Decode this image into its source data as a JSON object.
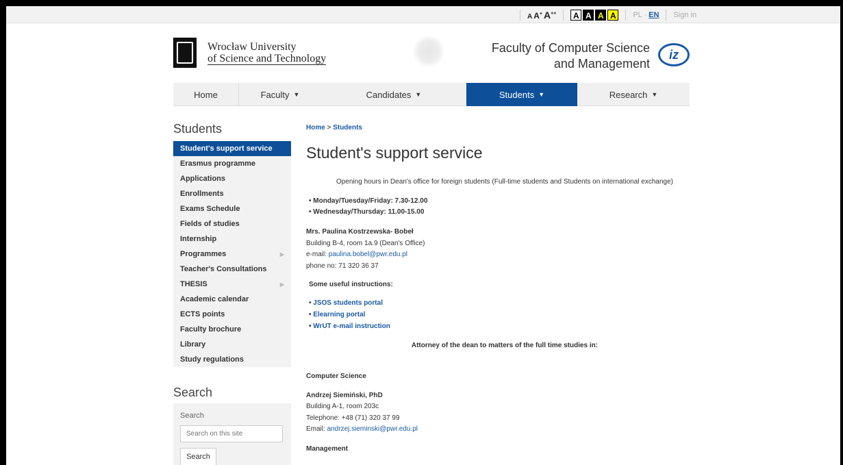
{
  "topbar": {
    "font_sizes": [
      "A",
      "A",
      "A"
    ],
    "font_size_marks": [
      "+",
      "++"
    ],
    "contrast": [
      "A",
      "A",
      "A",
      "A"
    ],
    "lang_pl": "PL",
    "lang_dot": "·",
    "lang_en": "EN",
    "sign_in": "Sign in"
  },
  "header": {
    "university_line1": "Wrocław University",
    "university_line2": "of Science and Technology",
    "faculty_line1": "Faculty of Computer Science",
    "faculty_line2": "and Management",
    "faculty_logo_text": "iz"
  },
  "nav": {
    "items": [
      {
        "label": "Home",
        "caret": ""
      },
      {
        "label": "Faculty",
        "caret": "▼"
      },
      {
        "label": "Candidates",
        "caret": "▼"
      },
      {
        "label": "Students",
        "caret": "▼"
      },
      {
        "label": "Research",
        "caret": "▼"
      }
    ]
  },
  "sidebar": {
    "title": "Students",
    "items": [
      {
        "label": "Student's support service",
        "arrow": ""
      },
      {
        "label": "Erasmus programme",
        "arrow": ""
      },
      {
        "label": "Applications",
        "arrow": ""
      },
      {
        "label": "Enrollments",
        "arrow": ""
      },
      {
        "label": "Exams Schedule",
        "arrow": ""
      },
      {
        "label": "Fields of studies",
        "arrow": ""
      },
      {
        "label": "Internship",
        "arrow": ""
      },
      {
        "label": "Programmes",
        "arrow": "▶"
      },
      {
        "label": "Teacher's Consultations",
        "arrow": ""
      },
      {
        "label": "THESIS",
        "arrow": "▶"
      },
      {
        "label": "Academic calendar",
        "arrow": ""
      },
      {
        "label": "ECTS points",
        "arrow": ""
      },
      {
        "label": "Faculty brochure",
        "arrow": ""
      },
      {
        "label": "Library",
        "arrow": ""
      },
      {
        "label": "Study regulations",
        "arrow": ""
      }
    ],
    "search_title": "Search",
    "search_label": "Search",
    "search_placeholder": "Search on this site",
    "search_button": "Search"
  },
  "main": {
    "breadcrumb_home": "Home",
    "breadcrumb_sep": ">",
    "breadcrumb_current": "Students",
    "title": "Student's support service",
    "opening_hours": "Opening hours in Dean's office for foreign students (Full-time students and Students on international exchange)",
    "hours": [
      "• Monday/Tuesday/Friday: 7.30-12.00",
      "• Wednesday/Thursday: 11.00-15.00"
    ],
    "contact1_name": "Mrs. Paulina Kostrzewska- Bobeł",
    "contact1_room": "Building B-4, room 1a.9 (Dean's Office)",
    "contact1_email_label": "e-mail: ",
    "contact1_email": "paulina.bobel@pwr.edu.pl",
    "contact1_phone": "phone no: 71 320 36 37",
    "useful_title": "Some useful instructions:",
    "bullet": "•",
    "useful_links": [
      "JSOS students portal",
      "Elearning portal",
      "WrUT e-mail instruction"
    ],
    "attorney": "Attorney of the dean to matters of the full time studies in:",
    "cs_heading": "Computer Science",
    "cs_name": "Andrzej Siemiński, PhD",
    "cs_room": "Building A-1, room 203c",
    "cs_phone": "Telephone: +48 (71) 320 37 99",
    "cs_email_label": "Email: ",
    "cs_email": "andrzej.sieminski@pwr.edu.pl",
    "mgmt_heading": "Management"
  }
}
